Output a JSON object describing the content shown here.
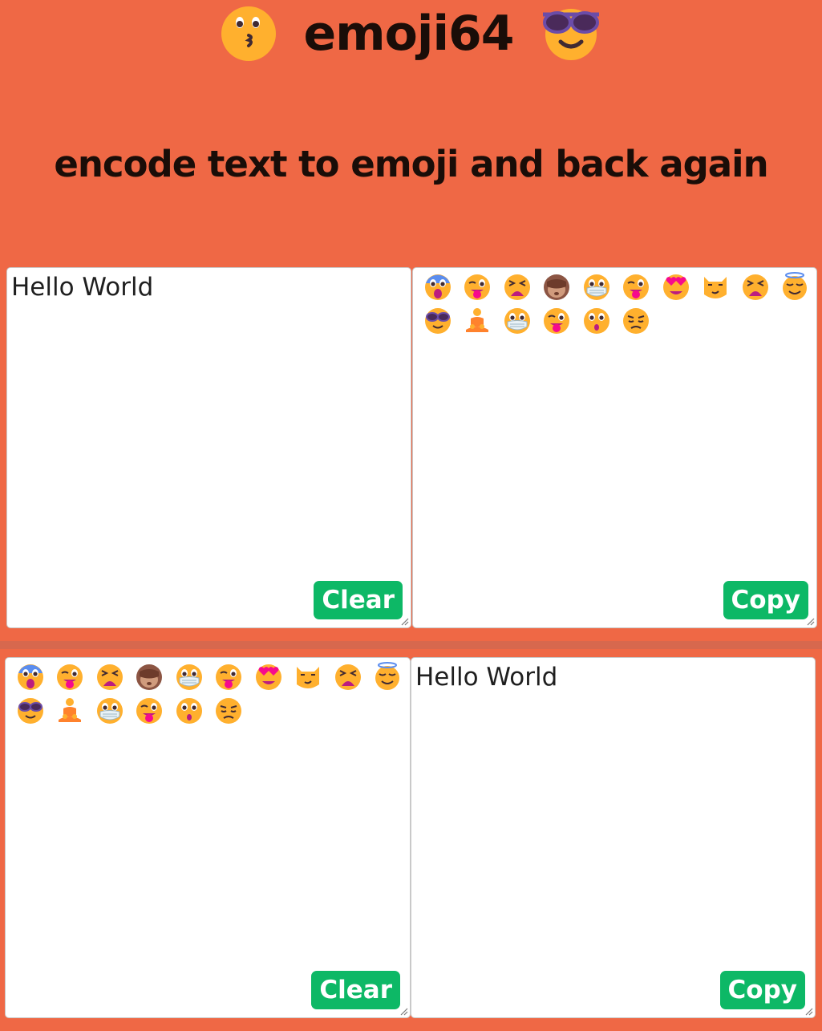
{
  "header": {
    "title": "emoji64",
    "subtitle": "encode text to emoji and back again",
    "left_icon": "kissing-face-icon",
    "right_icon": "sunglasses-face-icon"
  },
  "encoder": {
    "input_value": "Hello World",
    "clear_label": "Clear",
    "copy_label": "Copy",
    "output_emoji": [
      "screaming-face",
      "tongue-wink-face",
      "tired-face",
      "see-no-evil-monkey",
      "mask-face",
      "tongue-wink-face",
      "heart-eyes-face",
      "smirk-cat",
      "tired-face",
      "halo-face",
      "sunglasses-face",
      "person-in-lotus",
      "mask-face",
      "tongue-wink-face",
      "hushed-face",
      "pensive-face"
    ]
  },
  "decoder": {
    "input_emoji": [
      "screaming-face",
      "tongue-wink-face",
      "tired-face",
      "see-no-evil-monkey",
      "mask-face",
      "tongue-wink-face",
      "heart-eyes-face",
      "smirk-cat",
      "tired-face",
      "halo-face",
      "sunglasses-face",
      "person-in-lotus",
      "mask-face",
      "tongue-wink-face",
      "hushed-face",
      "pensive-face"
    ],
    "output_value": "Hello World",
    "clear_label": "Clear",
    "copy_label": "Copy"
  },
  "colors": {
    "background": "#EF6845",
    "button": "#0DB866",
    "emoji_yellow": "#FFB02E"
  }
}
